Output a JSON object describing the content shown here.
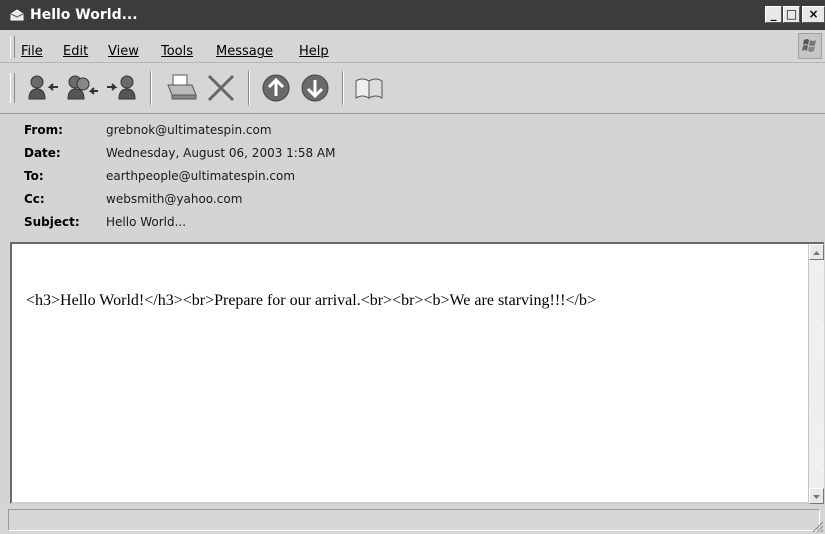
{
  "window": {
    "title": "Hello World...",
    "controls": {
      "minimize": "_",
      "maximize": "□",
      "close": "×"
    }
  },
  "menu": {
    "items": [
      "File",
      "Edit",
      "View",
      "Tools",
      "Message",
      "Help"
    ]
  },
  "toolbar": {
    "buttons": [
      {
        "name": "reply-icon"
      },
      {
        "name": "reply-all-icon"
      },
      {
        "name": "forward-icon"
      },
      {
        "name": "print-icon"
      },
      {
        "name": "delete-icon"
      },
      {
        "name": "previous-icon"
      },
      {
        "name": "next-icon"
      },
      {
        "name": "addresses-icon"
      }
    ]
  },
  "message": {
    "from_label": "From:",
    "from": "grebnok@ultimatespin.com",
    "date_label": "Date:",
    "date": "Wednesday, August 06, 2003 1:58 AM",
    "to_label": "To:",
    "to": "earthpeople@ultimatespin.com",
    "cc_label": "Cc:",
    "cc": "websmith@yahoo.com",
    "subject_label": "Subject:",
    "subject": "Hello World...",
    "body": "<h3>Hello World!</h3><br>Prepare for our arrival.<br><br><b>We are starving!!!</b>"
  },
  "colors": {
    "titlebar": "#3c3c3c",
    "chrome": "#d4d4d4",
    "body_bg": "#ffffff"
  }
}
